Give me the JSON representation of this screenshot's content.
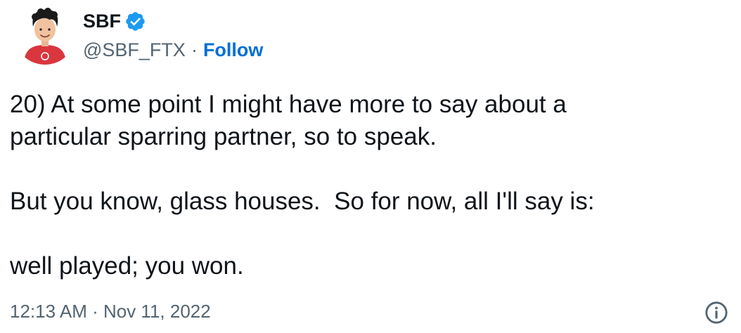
{
  "tweet": {
    "author": {
      "display_name": "SBF",
      "handle": "@SBF_FTX",
      "verified": true,
      "avatar_icon": "avatar-icon"
    },
    "separator": "·",
    "follow_label": "Follow",
    "body_paragraphs": [
      "20) At some point I might have more to say about a\nparticular sparring partner, so to speak.",
      "But you know, glass houses.  So for now, all I'll say is:",
      "well played; you won."
    ],
    "timestamp": "12:13 AM · Nov 11, 2022",
    "info_icon": "info-icon"
  },
  "colors": {
    "text": "#0f1419",
    "secondary": "#536471",
    "accent": "#006fd6",
    "verified": "#1d9bf0",
    "avatar_shirt": "#d9363e"
  }
}
